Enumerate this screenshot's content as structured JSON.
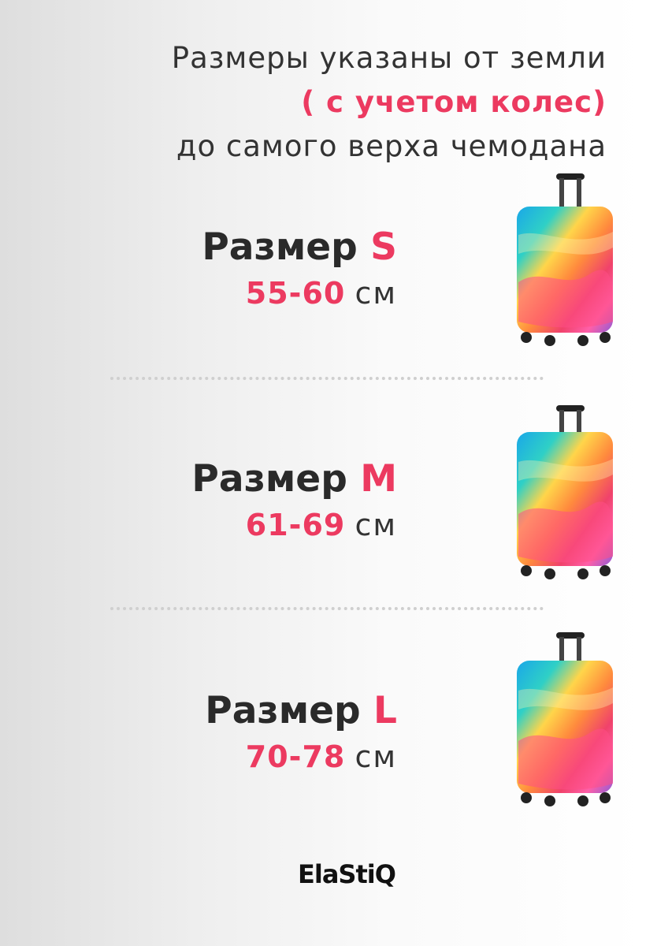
{
  "header": {
    "line1": "Размеры указаны от земли",
    "line2": "( с учетом колес)",
    "line3": "до самого верха чемодана"
  },
  "sizes": [
    {
      "word": "Размер",
      "letter": "S",
      "range": "55-60",
      "unit": "см"
    },
    {
      "word": "Размер",
      "letter": "M",
      "range": "61-69",
      "unit": "см"
    },
    {
      "word": "Размер",
      "letter": "L",
      "range": "70-78",
      "unit": "см"
    }
  ],
  "brand": {
    "logo_text": "ElaStiQ"
  },
  "colors": {
    "accent": "#ec3a60",
    "text": "#333333"
  },
  "suitcase_icon": "rainbow-wave-suitcase-cover"
}
